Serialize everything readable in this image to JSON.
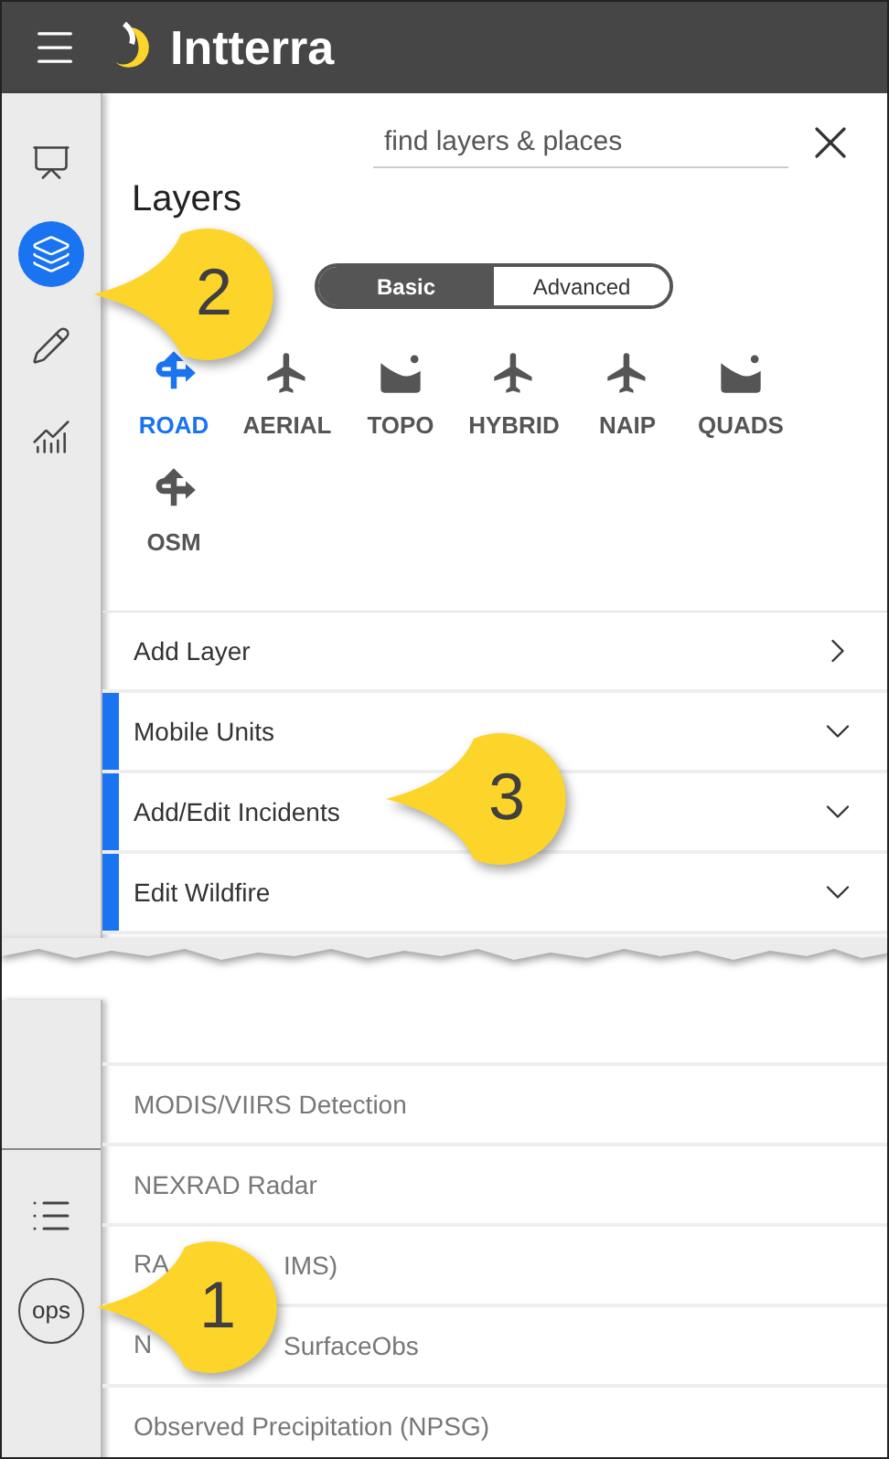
{
  "header": {
    "title": "Intterra"
  },
  "rail": {
    "top_items": [
      {
        "kind": "presentation",
        "selected": false
      },
      {
        "kind": "layers",
        "selected": true
      },
      {
        "kind": "pencil",
        "selected": false
      },
      {
        "kind": "chart",
        "selected": false
      }
    ],
    "bottom_items": [
      {
        "kind": "list"
      },
      {
        "kind": "badge",
        "label": "ops"
      }
    ]
  },
  "panel": {
    "search": {
      "placeholder": "find layers & places"
    },
    "title": "Layers",
    "toggle": [
      {
        "label": "Basic",
        "selected": true
      },
      {
        "label": "Advanced",
        "selected": false
      }
    ],
    "basemaps": [
      {
        "label": "ROAD",
        "kind": "road",
        "selected": true
      },
      {
        "label": "AERIAL",
        "kind": "plane",
        "selected": false
      },
      {
        "label": "TOPO",
        "kind": "terrain",
        "selected": false
      },
      {
        "label": "HYBRID",
        "kind": "plane",
        "selected": false
      },
      {
        "label": "NAIP",
        "kind": "plane",
        "selected": false
      },
      {
        "label": "QUADS",
        "kind": "terrain",
        "selected": false
      },
      {
        "label": "OSM",
        "kind": "road",
        "selected": false
      }
    ],
    "sections": [
      {
        "label": "Add Layer",
        "kind": "link",
        "marked": false
      },
      {
        "label": "Mobile Units",
        "kind": "expand",
        "marked": true
      },
      {
        "label": "Add/Edit Incidents",
        "kind": "expand",
        "marked": true
      },
      {
        "label": "Edit Wildfire",
        "kind": "expand",
        "marked": true
      }
    ],
    "layers": [
      {
        "parts": [
          "MODIS/VIIRS Detection"
        ]
      },
      {
        "parts": [
          "NEXRAD Radar"
        ]
      },
      {
        "parts": [
          "RA",
          "IMS)"
        ]
      },
      {
        "parts": [
          "N",
          "SurfaceObs"
        ]
      },
      {
        "parts": [
          "Observed Precipitation (NPSG)"
        ]
      }
    ]
  },
  "callouts": [
    {
      "number": "2"
    },
    {
      "number": "3"
    },
    {
      "number": "1"
    }
  ]
}
